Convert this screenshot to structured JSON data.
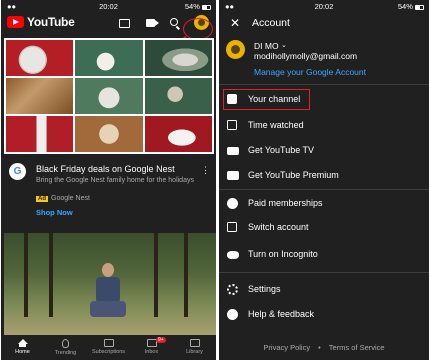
{
  "left": {
    "status": {
      "carrier": "●●",
      "time": "20:02",
      "battery": "54%"
    },
    "header": {
      "app_name": "YouTube"
    },
    "ad": {
      "advertiser_logo": "G",
      "title": "Black Friday deals on Google Nest",
      "description": "Bring the Google Nest family home for the holidays",
      "badge": "Ad",
      "advertiser": "Google Nest",
      "cta": "Shop Now",
      "more": "⋮"
    },
    "nav": {
      "items": [
        {
          "label": "Home"
        },
        {
          "label": "Trending"
        },
        {
          "label": "Subscriptions"
        },
        {
          "label": "Inbox",
          "badge": "9+"
        },
        {
          "label": "Library"
        }
      ]
    }
  },
  "right": {
    "status": {
      "carrier": "●●",
      "time": "20:02",
      "battery": "54%"
    },
    "header": {
      "close": "✕",
      "title": "Account"
    },
    "profile": {
      "name": "DI MO",
      "chevron": "⌄",
      "email": "modihollymolly@gmail.com",
      "manage": "Manage your Google Account"
    },
    "menu": [
      {
        "label": "Your channel",
        "icon": "person-icon"
      },
      {
        "label": "Time watched",
        "icon": "bar-chart-icon"
      },
      {
        "label": "Get YouTube TV",
        "icon": "tv-icon"
      },
      {
        "label": "Get YouTube Premium",
        "icon": "play-icon"
      },
      {
        "label": "Paid memberships",
        "icon": "dollar-icon"
      },
      {
        "label": "Switch account",
        "icon": "switch-account-icon"
      },
      {
        "label": "Turn on Incognito",
        "icon": "incognito-icon"
      },
      {
        "label": "Settings",
        "icon": "gear-icon"
      },
      {
        "label": "Help & feedback",
        "icon": "help-icon"
      }
    ],
    "footer": {
      "privacy": "Privacy Policy",
      "sep": "•",
      "terms": "Terms of Service"
    }
  },
  "annotation_color": "#e0202a"
}
